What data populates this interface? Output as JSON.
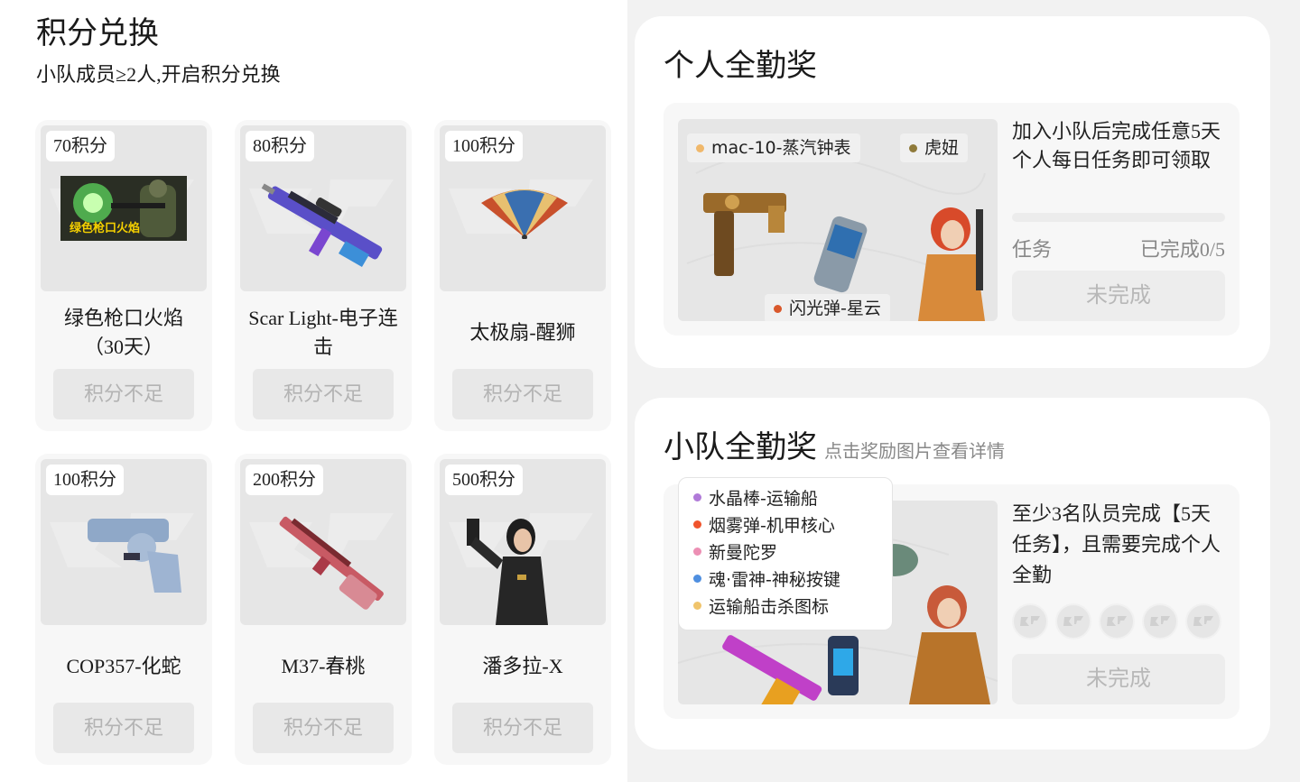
{
  "exchange": {
    "title": "积分兑换",
    "subtitle": "小队成员≥2人,开启积分兑换",
    "items": [
      {
        "points": "70积分",
        "name": "绿色枪口火焰\n（30天）",
        "image_caption": "绿色枪口火焰",
        "button": "积分不足",
        "icon": "muzzle-flame-icon"
      },
      {
        "points": "80积分",
        "name": "Scar Light-电子连\n击",
        "button": "积分不足",
        "icon": "rifle-icon"
      },
      {
        "points": "100积分",
        "name": "太极扇-醒狮",
        "button": "积分不足",
        "icon": "fan-icon"
      },
      {
        "points": "100积分",
        "name": "COP357-化蛇",
        "button": "积分不足",
        "icon": "pistol-icon"
      },
      {
        "points": "200积分",
        "name": "M37-春桃",
        "button": "积分不足",
        "icon": "shotgun-icon"
      },
      {
        "points": "500积分",
        "name": "潘多拉-X",
        "button": "积分不足",
        "icon": "character-icon"
      }
    ]
  },
  "personal": {
    "title": "个人全勤奖",
    "tags": [
      {
        "label": "mac-10-蒸汽钟表",
        "color": "#f0b86b"
      },
      {
        "label": "虎妞",
        "color": "#8f7a3a"
      },
      {
        "label": "闪光弹-星云",
        "color": "#d9582b"
      }
    ],
    "description": "加入小队后完成任意5天个人每日任务即可领取",
    "progress": 0,
    "task_label": "任务",
    "task_value": "已完成0/5",
    "status": "未完成"
  },
  "team": {
    "title": "小队全勤奖",
    "hint": "点击奖励图片查看详情",
    "legend": [
      {
        "label": "水晶棒-运输船",
        "color": "#b07ad8"
      },
      {
        "label": "烟雾弹-机甲核心",
        "color": "#f0542c"
      },
      {
        "label": "新曼陀罗",
        "color": "#ec8fb4"
      },
      {
        "label": "魂·雷神-神秘按键",
        "color": "#4f8fe0"
      },
      {
        "label": "运输船击杀图标",
        "color": "#f0c46b"
      }
    ],
    "description": "至少3名队员完成【5天任务】，且需要完成个人全勤",
    "member_slots": 5,
    "status": "未完成"
  }
}
